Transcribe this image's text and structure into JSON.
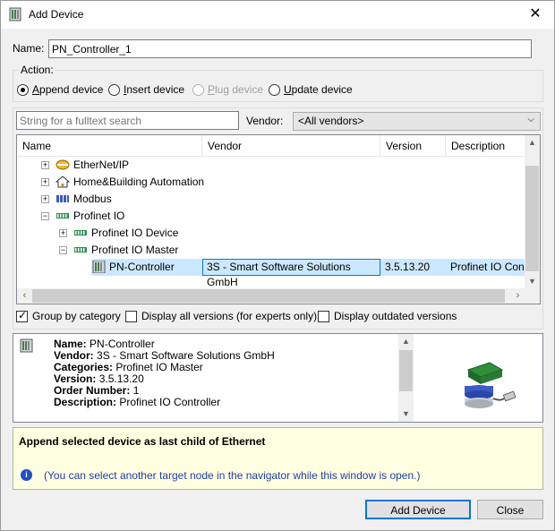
{
  "window": {
    "title": "Add Device",
    "close_glyph": "✕"
  },
  "name_field": {
    "label": "Name:",
    "value": "PN_Controller_1"
  },
  "action": {
    "legend": "Action:",
    "options": [
      {
        "prefix": "",
        "accel": "A",
        "rest": "ppend device",
        "checked": true,
        "enabled": true
      },
      {
        "prefix": "",
        "accel": "I",
        "rest": "nsert device",
        "checked": false,
        "enabled": true
      },
      {
        "prefix": "",
        "accel": "P",
        "rest": "lug device",
        "checked": false,
        "enabled": false
      },
      {
        "prefix": "",
        "accel": "U",
        "rest": "pdate device",
        "checked": false,
        "enabled": true
      }
    ]
  },
  "search": {
    "placeholder": "String for a fulltext search"
  },
  "vendor": {
    "label": "Vendor:",
    "selected": "<All vendors>"
  },
  "tree": {
    "columns": [
      "Name",
      "Vendor",
      "Version",
      "Description"
    ],
    "nodes": [
      {
        "label": "EtherNet/IP",
        "icon": "ethernet-ip-icon",
        "expander": "+"
      },
      {
        "label": "Home&Building Automation",
        "icon": "house-icon",
        "expander": "+"
      },
      {
        "label": "Modbus",
        "icon": "modbus-icon",
        "expander": "+"
      },
      {
        "label": "Profinet IO",
        "icon": "profinet-icon",
        "expander": "−"
      },
      {
        "label": "Profinet IO Device",
        "icon": "profinet-icon",
        "expander": "+"
      },
      {
        "label": "Profinet IO Master",
        "icon": "profinet-icon",
        "expander": "−"
      },
      {
        "label": "PN-Controller",
        "icon": "device-icon",
        "expander": ""
      }
    ],
    "selected_row": {
      "vendor": "3S - Smart Software Solutions GmbH",
      "version": "3.5.13.20",
      "description": "Profinet IO Contr"
    }
  },
  "options": {
    "group_by_category": {
      "label": "Group by category",
      "checked": true
    },
    "display_all_versions": {
      "label": "Display all versions (for experts only)",
      "checked": false
    },
    "display_outdated": {
      "label": "Display outdated versions",
      "checked": false
    }
  },
  "info": {
    "name": {
      "key": "Name:",
      "value": "PN-Controller"
    },
    "vendor": {
      "key": "Vendor:",
      "value": "3S - Smart Software Solutions GmbH"
    },
    "categories": {
      "key": "Categories:",
      "value": "Profinet IO Master"
    },
    "version": {
      "key": "Version:",
      "value": "3.5.13.20"
    },
    "order_number": {
      "key": "Order Number:",
      "value": "1"
    },
    "description": {
      "key": "Description:",
      "value": "Profinet IO Controller"
    }
  },
  "hint": {
    "title": "Append selected device as last child of Ethernet",
    "note": "(You can select another target node in the navigator while this window is open.)",
    "icon_glyph": "i"
  },
  "buttons": {
    "add": "Add Device",
    "close": "Close"
  },
  "glyphs": {
    "up": "▲",
    "down": "▼",
    "left": "‹",
    "right": "›",
    "select": "⌵"
  }
}
